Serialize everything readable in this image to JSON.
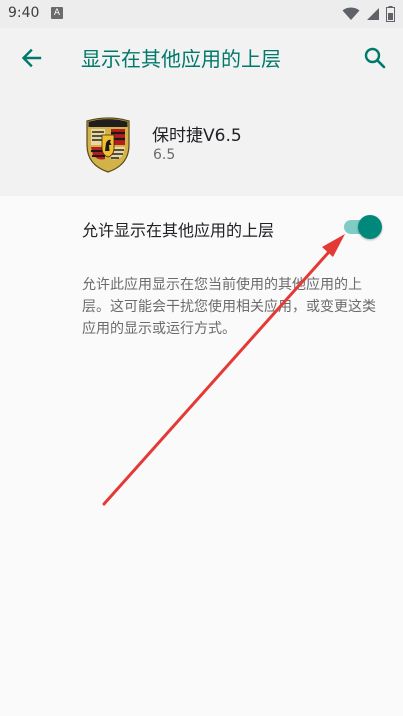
{
  "status_bar": {
    "time": "9:40",
    "notification_icon_letter": "A",
    "icons": [
      "wifi-icon",
      "signal-icon",
      "battery-icon"
    ]
  },
  "app_bar": {
    "title": "显示在其他应用的上层",
    "back_icon": "arrow-back-icon",
    "search_icon": "search-icon"
  },
  "app_info": {
    "name": "保时捷V6.5",
    "version": "6.5",
    "logo_icon": "porsche-crest-icon"
  },
  "permission": {
    "label": "允许显示在其他应用的上层",
    "enabled": true,
    "description": "允许此应用显示在您当前使用的其他应用的上层。这可能会干扰您使用相关应用，或变更这类应用的显示或运行方式。"
  },
  "colors": {
    "accent": "#00796b",
    "toggle_thumb": "#00897b",
    "toggle_track": "#80cbc4",
    "annotation_arrow": "#e53935",
    "header_background": "#f2f2f2",
    "page_background": "#fafafa"
  }
}
